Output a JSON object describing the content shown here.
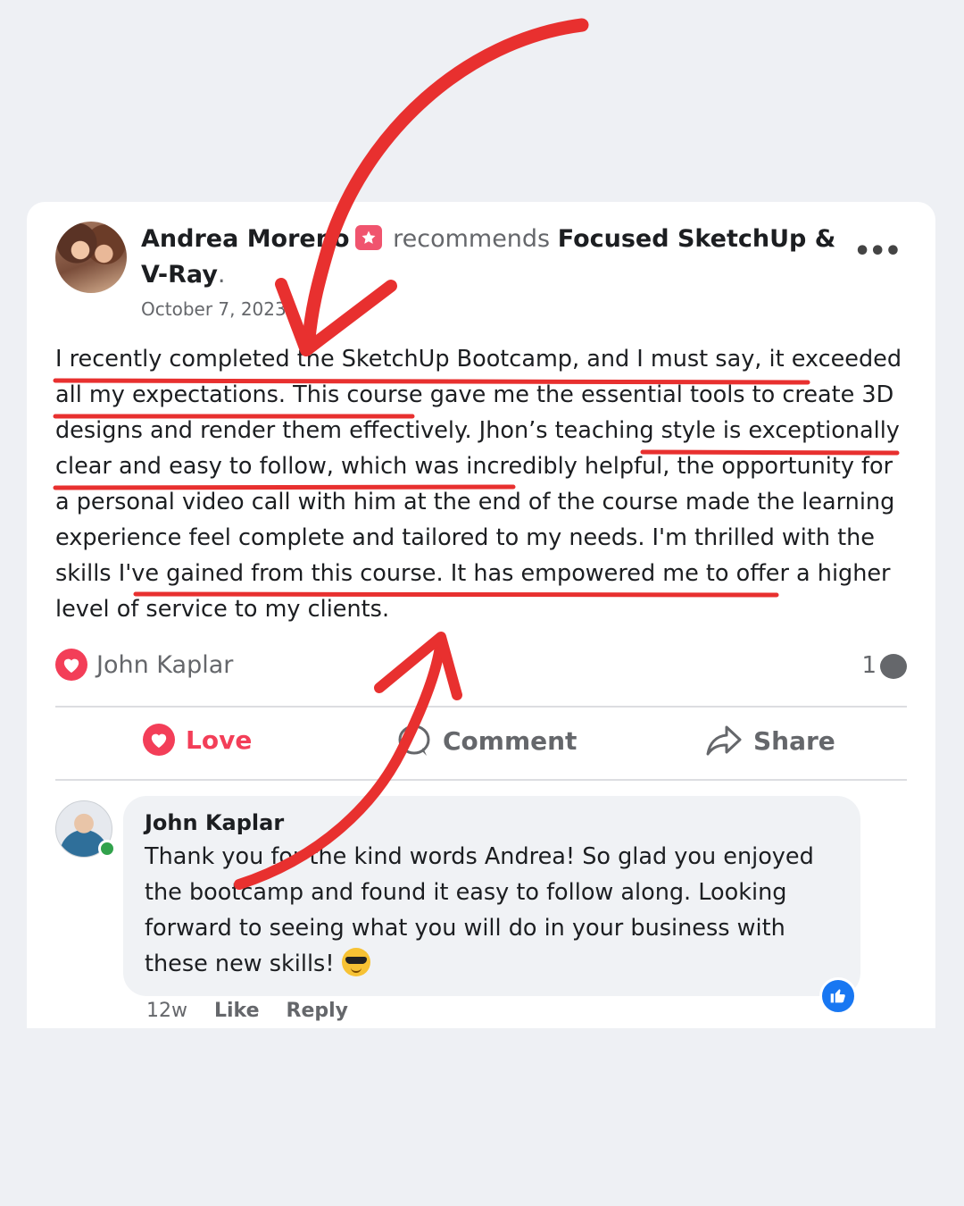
{
  "post": {
    "author": "Andrea Moreno",
    "verb": "recommends",
    "page_name": "Focused SketchUp & V-Ray",
    "punct": ".",
    "date": "October 7, 2023",
    "more_label": "•••",
    "body": "I recently completed the SketchUp Bootcamp, and I must say, it exceeded all my expectations. This course gave me the essential tools to create 3D designs and render them effectively. Jhon’s teaching style is exceptionally clear and easy to follow, which was incredibly helpful, the opportunity for a personal video call with him at the end of the course made the learning experience feel complete and tailored to my needs. I'm thrilled with the skills I've gained from this course. It has empowered me to offer a higher level of service to my clients."
  },
  "reactions": {
    "reactor": "John Kaplar",
    "comment_count": "1"
  },
  "actions": {
    "love": "Love",
    "comment": "Comment",
    "share": "Share"
  },
  "reply": {
    "author": "John Kaplar",
    "text": "Thank you for the kind words Andrea! So glad you enjoyed the bootcamp and found it easy to follow along. Looking forward to seeing what you will do in your business with these new skills!",
    "time": "12w",
    "like_label": "Like",
    "reply_label": "Reply"
  },
  "colors": {
    "page_bg": "#eef0f4",
    "annotation_red": "#e8302f",
    "love_red": "#f33e58",
    "like_blue": "#1877f2"
  }
}
